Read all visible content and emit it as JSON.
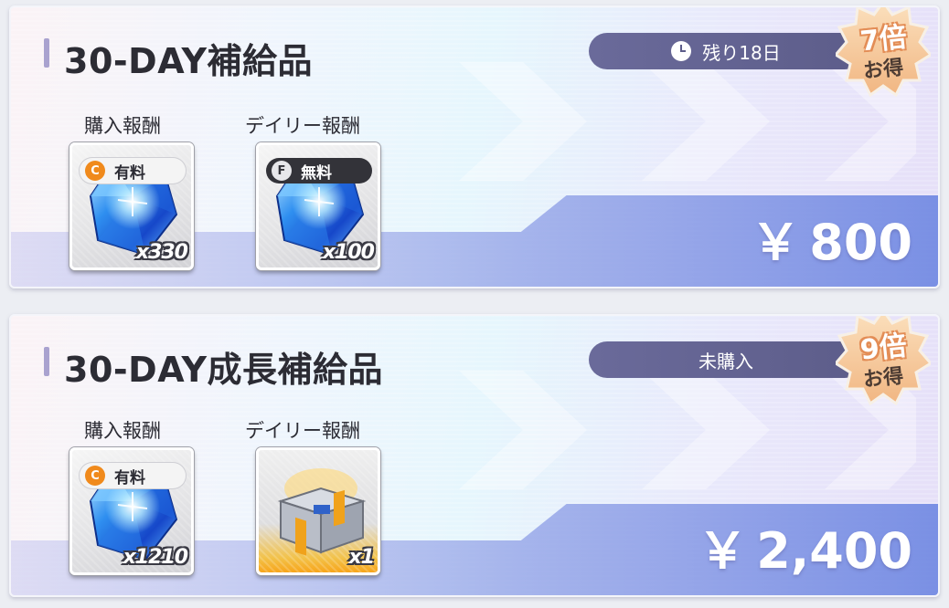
{
  "cards": [
    {
      "title": "30-DAY補給品",
      "status": "残り18日",
      "badge_multiplier": "7倍",
      "badge_text": "お得",
      "purchase_label": "購入報酬",
      "daily_label": "デイリー報酬",
      "purchase_reward": {
        "tag": "有料",
        "tag_icon": "C",
        "quantity": "x330",
        "item": "blue-crystal"
      },
      "daily_reward": {
        "tag": "無料",
        "tag_icon": "F",
        "quantity": "x100",
        "item": "blue-crystal"
      },
      "currency": "￥",
      "price": "800"
    },
    {
      "title": "30-DAY成長補給品",
      "status": "未購入",
      "badge_multiplier": "9倍",
      "badge_text": "お得",
      "purchase_label": "購入報酬",
      "daily_label": "デイリー報酬",
      "purchase_reward": {
        "tag": "有料",
        "tag_icon": "C",
        "quantity": "x1210",
        "item": "blue-crystal"
      },
      "daily_reward": {
        "quantity": "x1",
        "item": "supply-crate"
      },
      "currency": "￥",
      "price": "2,400"
    }
  ],
  "colors": {
    "status_pill": "#5d5d8a",
    "badge": "#f6c99b",
    "paid_coin": "#f08a1c",
    "title_accent": "#a9a2cf"
  }
}
